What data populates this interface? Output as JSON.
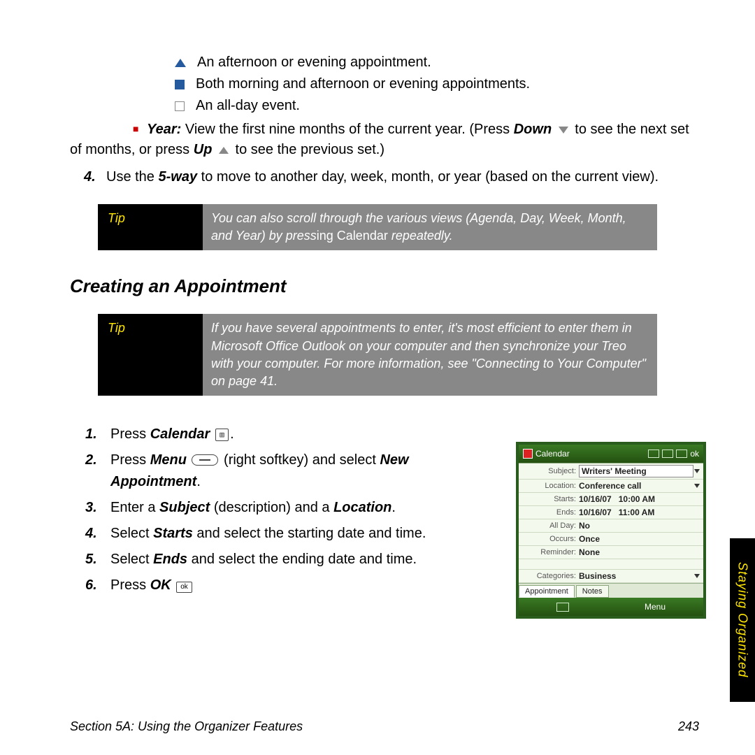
{
  "icons": {
    "afternoon": "An afternoon or evening appointment.",
    "both": "Both morning and afternoon or evening appointments.",
    "allday": "An all-day event."
  },
  "year_line": {
    "label": "Year:",
    "text1": " View the first nine months of the current year. (Press ",
    "down": "Down",
    "text2": " to see the next set of months, or press ",
    "up": "Up",
    "text3": " to see the previous set.)"
  },
  "step4": {
    "num": "4.",
    "t1": "Use the ",
    "bold": "5-way",
    "t2": " to move to another day, week, month, or year (based on the current view)."
  },
  "tip1": {
    "label": "Tip",
    "t1": "You can also scroll through the various views (Agenda, Day, Week, Month, and Year) by press",
    "non_it": "ing Calendar",
    "t2": " repeatedly."
  },
  "section_head": "Creating an Appointment",
  "tip2": {
    "label": "Tip",
    "body": "If you have several appointments to enter, it's most efficient to enter them in Microsoft Office Outlook on your computer and then synchronize your Treo with your computer. For more information, see \"Connecting to Your Computer\" on page 41."
  },
  "steps": {
    "s1": {
      "n": "1.",
      "t1": "Press ",
      "b": "Calendar",
      "t2": " ",
      "end": "."
    },
    "s2": {
      "n": "2.",
      "t1": "Press ",
      "b": "Menu",
      "t2": " (right softkey) and select ",
      "b2": "New Appointment",
      "t3": "."
    },
    "s3": {
      "n": "3.",
      "t1": "Enter a ",
      "b": "Subject",
      "t2": " (description) and a ",
      "b2": "Location",
      "t3": "."
    },
    "s4": {
      "n": "4.",
      "t1": "Select ",
      "b": "Starts",
      "t2": " and select the starting date and time."
    },
    "s5": {
      "n": "5.",
      "t1": "Select ",
      "b": "Ends",
      "t2": " and select the ending date and time."
    },
    "s6": {
      "n": "6.",
      "t1": "Press ",
      "b": "OK",
      "t2": " "
    }
  },
  "icon_labels": {
    "calendar_glyph": "⊞",
    "ok_glyph": "ok"
  },
  "phone": {
    "title": "Calendar",
    "ok": "ok",
    "rows": {
      "subject": {
        "l": "Subject:",
        "v": "Writers' Meeting"
      },
      "location": {
        "l": "Location:",
        "v": "Conference call"
      },
      "starts": {
        "l": "Starts:",
        "v": "10/16/07",
        "v2": "10:00 AM"
      },
      "ends": {
        "l": "Ends:",
        "v": "10/16/07",
        "v2": "11:00 AM"
      },
      "allday": {
        "l": "All Day:",
        "v": "No"
      },
      "occurs": {
        "l": "Occurs:",
        "v": "Once"
      },
      "reminder": {
        "l": "Reminder:",
        "v": "None"
      },
      "categories": {
        "l": "Categories:",
        "v": "Business"
      }
    },
    "tabs": {
      "t1": "Appointment",
      "t2": "Notes"
    },
    "menu": "Menu"
  },
  "side_tab": "Staying Organized",
  "footer": {
    "left": "Section 5A: Using the Organizer Features",
    "right": "243"
  }
}
